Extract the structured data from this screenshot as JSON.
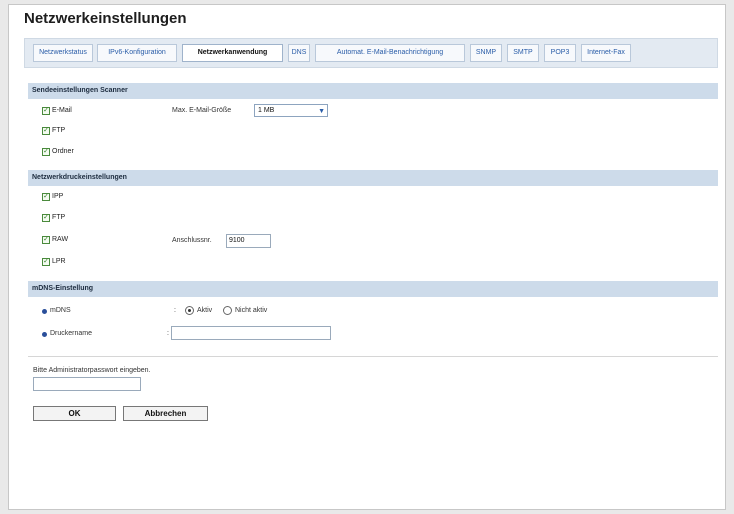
{
  "page": {
    "title": "Netzwerkeinstellungen"
  },
  "tabs": [
    {
      "label": "Netzwerkstatus",
      "active": false
    },
    {
      "label": "IPv6-Konfiguration",
      "active": false
    },
    {
      "label": "Netzwerkanwendung",
      "active": true
    },
    {
      "label": "DNS",
      "active": false
    },
    {
      "label": "Automat. E-Mail-Benachrichtigung",
      "active": false
    },
    {
      "label": "SNMP",
      "active": false
    },
    {
      "label": "SMTP",
      "active": false
    },
    {
      "label": "POP3",
      "active": false
    },
    {
      "label": "Internet-Fax",
      "active": false
    }
  ],
  "scanner": {
    "header": "Sendeeinstellungen Scanner",
    "email_label": "E-Mail",
    "ftp_label": "FTP",
    "folder_label": "Ordner",
    "max_size_label": "Max. E-Mail-Größe",
    "max_size_value": "1 MB"
  },
  "netprint": {
    "header": "Netzwerkdruckeinstellungen",
    "ipp_label": "IPP",
    "ftp_label": "FTP",
    "raw_label": "RAW",
    "lpr_label": "LPR",
    "port_label": "Anschlussnr.",
    "port_value": "9100"
  },
  "mdns": {
    "header": "mDNS-Einstellung",
    "mdns_label": "mDNS",
    "colon": ":",
    "active_label": "Aktiv",
    "inactive_label": "Nicht aktiv",
    "printer_name_label": "Druckername",
    "printer_name_value": ""
  },
  "admin": {
    "prompt": "Bitte Administratorpasswort eingeben.",
    "password_value": ""
  },
  "buttons": {
    "ok": "OK",
    "cancel": "Abbrechen"
  }
}
